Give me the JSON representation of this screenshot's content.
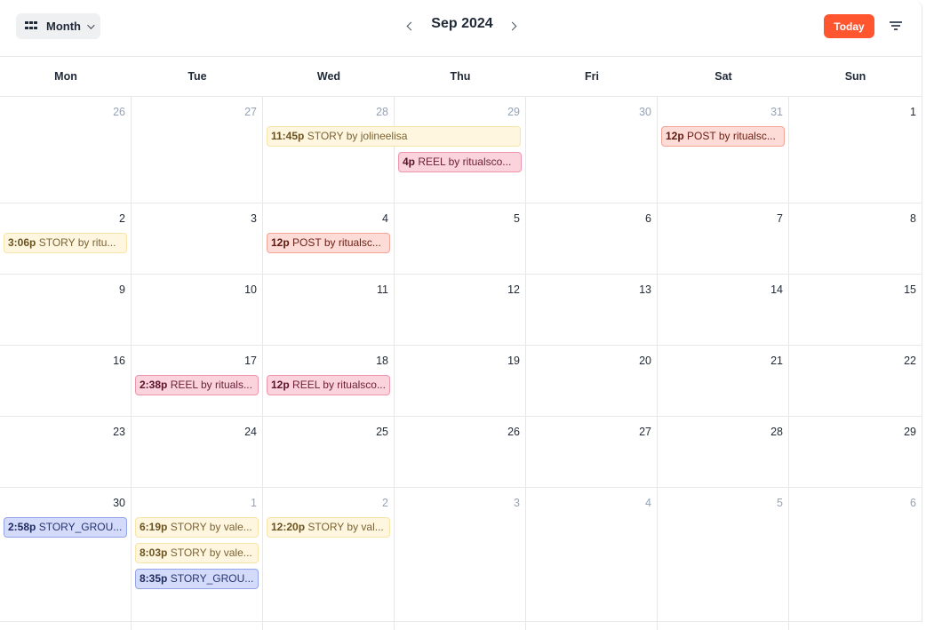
{
  "toolbar": {
    "view_label": "Month",
    "view_icon": "grid-icon",
    "month_title": "Sep 2024",
    "prev_icon": "chevron-left-icon",
    "next_icon": "chevron-right-icon",
    "today_label": "Today",
    "filter_icon": "filter-icon"
  },
  "days_of_week": [
    "Mon",
    "Tue",
    "Wed",
    "Thu",
    "Fri",
    "Sat",
    "Sun"
  ],
  "colors": {
    "today_button": "#ff5630",
    "story": "#fef6de",
    "reel": "#fbd3dd",
    "post": "#fddbd6",
    "story_group": "#d3dafa"
  },
  "weeks": [
    {
      "days": [
        {
          "num": "26",
          "other": true,
          "events": []
        },
        {
          "num": "27",
          "other": true,
          "events": []
        },
        {
          "num": "28",
          "other": true,
          "events": [
            {
              "time": "11:45p",
              "text": "STORY by jolineelisa",
              "type": "story",
              "span": 2
            }
          ]
        },
        {
          "num": "29",
          "other": true,
          "events": [
            {
              "spacer": true
            },
            {
              "time": "4p",
              "text": "REEL by ritualsco...",
              "type": "reel"
            }
          ]
        },
        {
          "num": "30",
          "other": true,
          "events": []
        },
        {
          "num": "31",
          "other": true,
          "events": [
            {
              "time": "12p",
              "text": "POST by ritualsc...",
              "type": "post"
            }
          ]
        },
        {
          "num": "1",
          "other": false,
          "events": []
        }
      ]
    },
    {
      "days": [
        {
          "num": "2",
          "other": false,
          "events": [
            {
              "time": "3:06p",
              "text": "STORY by ritu...",
              "type": "story"
            }
          ]
        },
        {
          "num": "3",
          "other": false,
          "events": []
        },
        {
          "num": "4",
          "other": false,
          "events": [
            {
              "time": "12p",
              "text": "POST by ritualsc...",
              "type": "post"
            }
          ]
        },
        {
          "num": "5",
          "other": false,
          "events": []
        },
        {
          "num": "6",
          "other": false,
          "events": []
        },
        {
          "num": "7",
          "other": false,
          "events": []
        },
        {
          "num": "8",
          "other": false,
          "events": []
        }
      ]
    },
    {
      "days": [
        {
          "num": "9",
          "other": false,
          "events": []
        },
        {
          "num": "10",
          "other": false,
          "events": []
        },
        {
          "num": "11",
          "other": false,
          "events": []
        },
        {
          "num": "12",
          "other": false,
          "events": []
        },
        {
          "num": "13",
          "other": false,
          "events": []
        },
        {
          "num": "14",
          "other": false,
          "events": []
        },
        {
          "num": "15",
          "other": false,
          "events": []
        }
      ]
    },
    {
      "days": [
        {
          "num": "16",
          "other": false,
          "events": []
        },
        {
          "num": "17",
          "other": false,
          "events": [
            {
              "time": "2:38p",
              "text": "REEL by rituals...",
              "type": "reel"
            }
          ]
        },
        {
          "num": "18",
          "other": false,
          "events": [
            {
              "time": "12p",
              "text": "REEL by ritualsco...",
              "type": "reel"
            }
          ]
        },
        {
          "num": "19",
          "other": false,
          "events": []
        },
        {
          "num": "20",
          "other": false,
          "events": []
        },
        {
          "num": "21",
          "other": false,
          "events": []
        },
        {
          "num": "22",
          "other": false,
          "events": []
        }
      ]
    },
    {
      "days": [
        {
          "num": "23",
          "other": false,
          "events": []
        },
        {
          "num": "24",
          "other": false,
          "events": []
        },
        {
          "num": "25",
          "other": false,
          "events": []
        },
        {
          "num": "26",
          "other": false,
          "events": []
        },
        {
          "num": "27",
          "other": false,
          "events": []
        },
        {
          "num": "28",
          "other": false,
          "events": []
        },
        {
          "num": "29",
          "other": false,
          "events": []
        }
      ]
    },
    {
      "days": [
        {
          "num": "30",
          "other": false,
          "events": [
            {
              "time": "2:58p",
              "text": "STORY_GROU...",
              "type": "group"
            }
          ]
        },
        {
          "num": "1",
          "other": true,
          "events": [
            {
              "time": "6:19p",
              "text": "STORY by vale...",
              "type": "story"
            },
            {
              "time": "8:03p",
              "text": "STORY by vale...",
              "type": "story"
            },
            {
              "time": "8:35p",
              "text": "STORY_GROU...",
              "type": "group"
            }
          ]
        },
        {
          "num": "2",
          "other": true,
          "events": [
            {
              "time": "12:20p",
              "text": "STORY by val...",
              "type": "story"
            }
          ]
        },
        {
          "num": "3",
          "other": true,
          "events": []
        },
        {
          "num": "4",
          "other": true,
          "events": []
        },
        {
          "num": "5",
          "other": true,
          "events": []
        },
        {
          "num": "6",
          "other": true,
          "events": []
        }
      ]
    }
  ]
}
